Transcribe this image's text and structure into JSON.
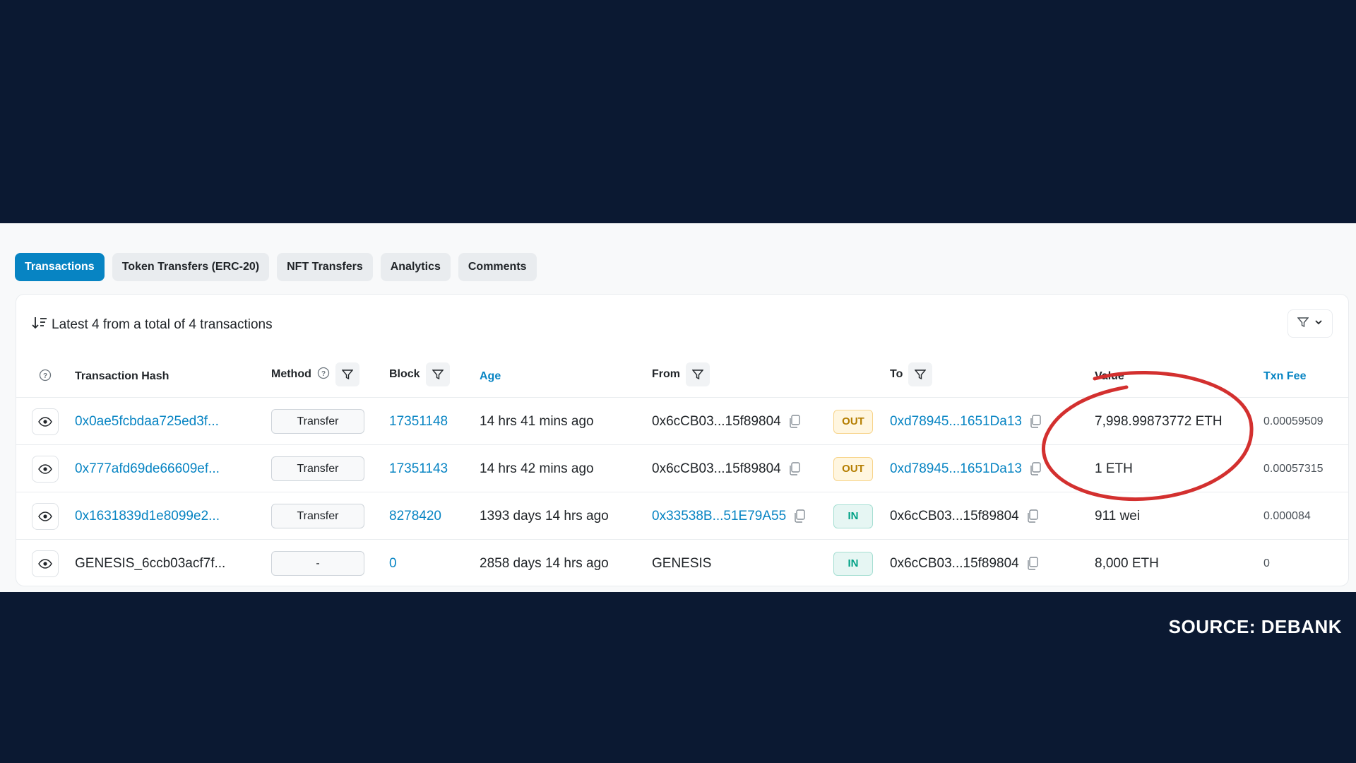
{
  "tabs": [
    {
      "label": "Transactions",
      "active": true
    },
    {
      "label": "Token Transfers (ERC-20)",
      "active": false
    },
    {
      "label": "NFT Transfers",
      "active": false
    },
    {
      "label": "Analytics",
      "active": false
    },
    {
      "label": "Comments",
      "active": false
    }
  ],
  "summary": "Latest 4 from a total of 4 transactions",
  "columns": {
    "hash": "Transaction Hash",
    "method": "Method",
    "block": "Block",
    "age": "Age",
    "from": "From",
    "to": "To",
    "value": "Value",
    "fee": "Txn Fee"
  },
  "rows": [
    {
      "hash": "0x0ae5fcbdaa725ed3f...",
      "method": "Transfer",
      "block": "17351148",
      "age": "14 hrs 41 mins ago",
      "from": "0x6cCB03...15f89804",
      "direction": "OUT",
      "to": "0xd78945...1651Da13",
      "value": "7,998.99873772 ETH",
      "fee": "0.00059509"
    },
    {
      "hash": "0x777afd69de66609ef...",
      "method": "Transfer",
      "block": "17351143",
      "age": "14 hrs 42 mins ago",
      "from": "0x6cCB03...15f89804",
      "direction": "OUT",
      "to": "0xd78945...1651Da13",
      "value": "1 ETH",
      "fee": "0.00057315"
    },
    {
      "hash": "0x1631839d1e8099e2...",
      "method": "Transfer",
      "block": "8278420",
      "age": "1393 days 14 hrs ago",
      "from": "0x33538B...51E79A55",
      "direction": "IN",
      "to": "0x6cCB03...15f89804",
      "value": "911 wei",
      "fee": "0.000084"
    },
    {
      "hash": "GENESIS_6ccb03acf7f...",
      "method": "-",
      "block": "0",
      "age": "2858 days 14 hrs ago",
      "from": "GENESIS",
      "direction": "IN",
      "to": "0x6cCB03...15f89804",
      "value": "8,000 ETH",
      "fee": "0"
    }
  ],
  "source": "SOURCE: DEBANK",
  "colors": {
    "accent": "#0784c3",
    "background": "#0b1932",
    "highlight_circle": "#d3302f"
  }
}
